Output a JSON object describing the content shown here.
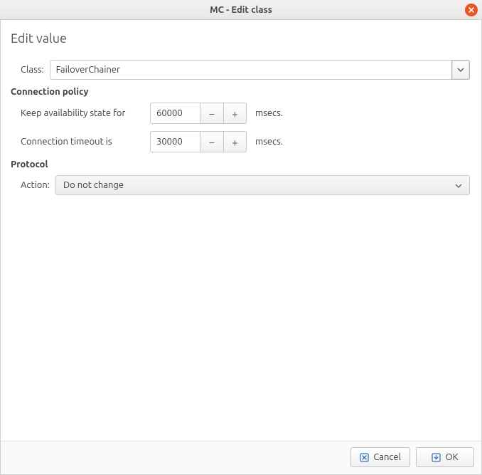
{
  "window": {
    "title": "MC - Edit class"
  },
  "page": {
    "title": "Edit value"
  },
  "class_row": {
    "label": "Class:",
    "value": "FailoverChainer"
  },
  "sections": {
    "connection_policy": "Connection policy",
    "protocol": "Protocol"
  },
  "policy": {
    "availability_label": "Keep availability state for",
    "availability_value": "60000",
    "timeout_label": "Connection timeout is",
    "timeout_value": "30000",
    "units": "msecs."
  },
  "protocol": {
    "action_label": "Action:",
    "action_value": "Do not change"
  },
  "buttons": {
    "cancel": "Cancel",
    "ok": "OK"
  }
}
